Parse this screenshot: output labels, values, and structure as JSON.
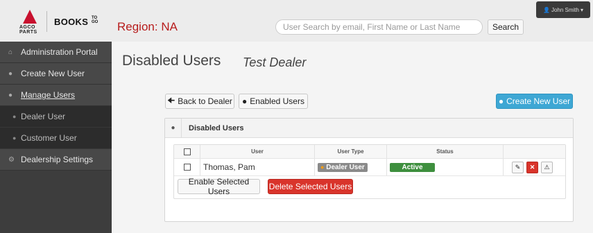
{
  "header": {
    "logo": {
      "agco": "AGCO PARTS",
      "books": "BOOKS",
      "togo": "TO GO"
    },
    "region": "Region: NA",
    "search": {
      "placeholder": "User Search by email, First Name or Last Name",
      "button_label": "Search"
    },
    "user_menu": {
      "label": "John Smith",
      "icon": "user-icon",
      "caret": "caret-down-icon"
    }
  },
  "sidebar": {
    "items": [
      {
        "label": "Administration Portal",
        "icon": "home-icon"
      },
      {
        "label": "Create New User",
        "icon": "user-icon"
      },
      {
        "label": "Manage Users",
        "icon": "user-icon",
        "active": true
      },
      {
        "label": "Dealer User",
        "icon": "user-icon",
        "sub": true
      },
      {
        "label": "Customer User",
        "icon": "user-icon",
        "sub": true
      },
      {
        "label": "Dealership Settings",
        "icon": "gear-icon"
      }
    ]
  },
  "main": {
    "title": "Disabled Users",
    "dealer_name": "Test Dealer",
    "back_button": "Back to Dealer",
    "enabled_users_button": "Enabled Users",
    "create_user_button": "Create New User"
  },
  "panel": {
    "title": "Disabled Users",
    "columns": [
      "User",
      "User Type",
      "Status"
    ],
    "rows": [
      {
        "user": "Thomas, Pam",
        "user_type": "Dealer User",
        "status": "Active"
      }
    ],
    "enable_button": "Enable Selected Users",
    "delete_button": "Delete Selected Users"
  },
  "colors": {
    "region": "#b71c1c",
    "primary_button": "#3ea7d4",
    "danger_button": "#d9342b",
    "status_active": "#3e8f3e",
    "sidebar": "#3d3d3d"
  }
}
